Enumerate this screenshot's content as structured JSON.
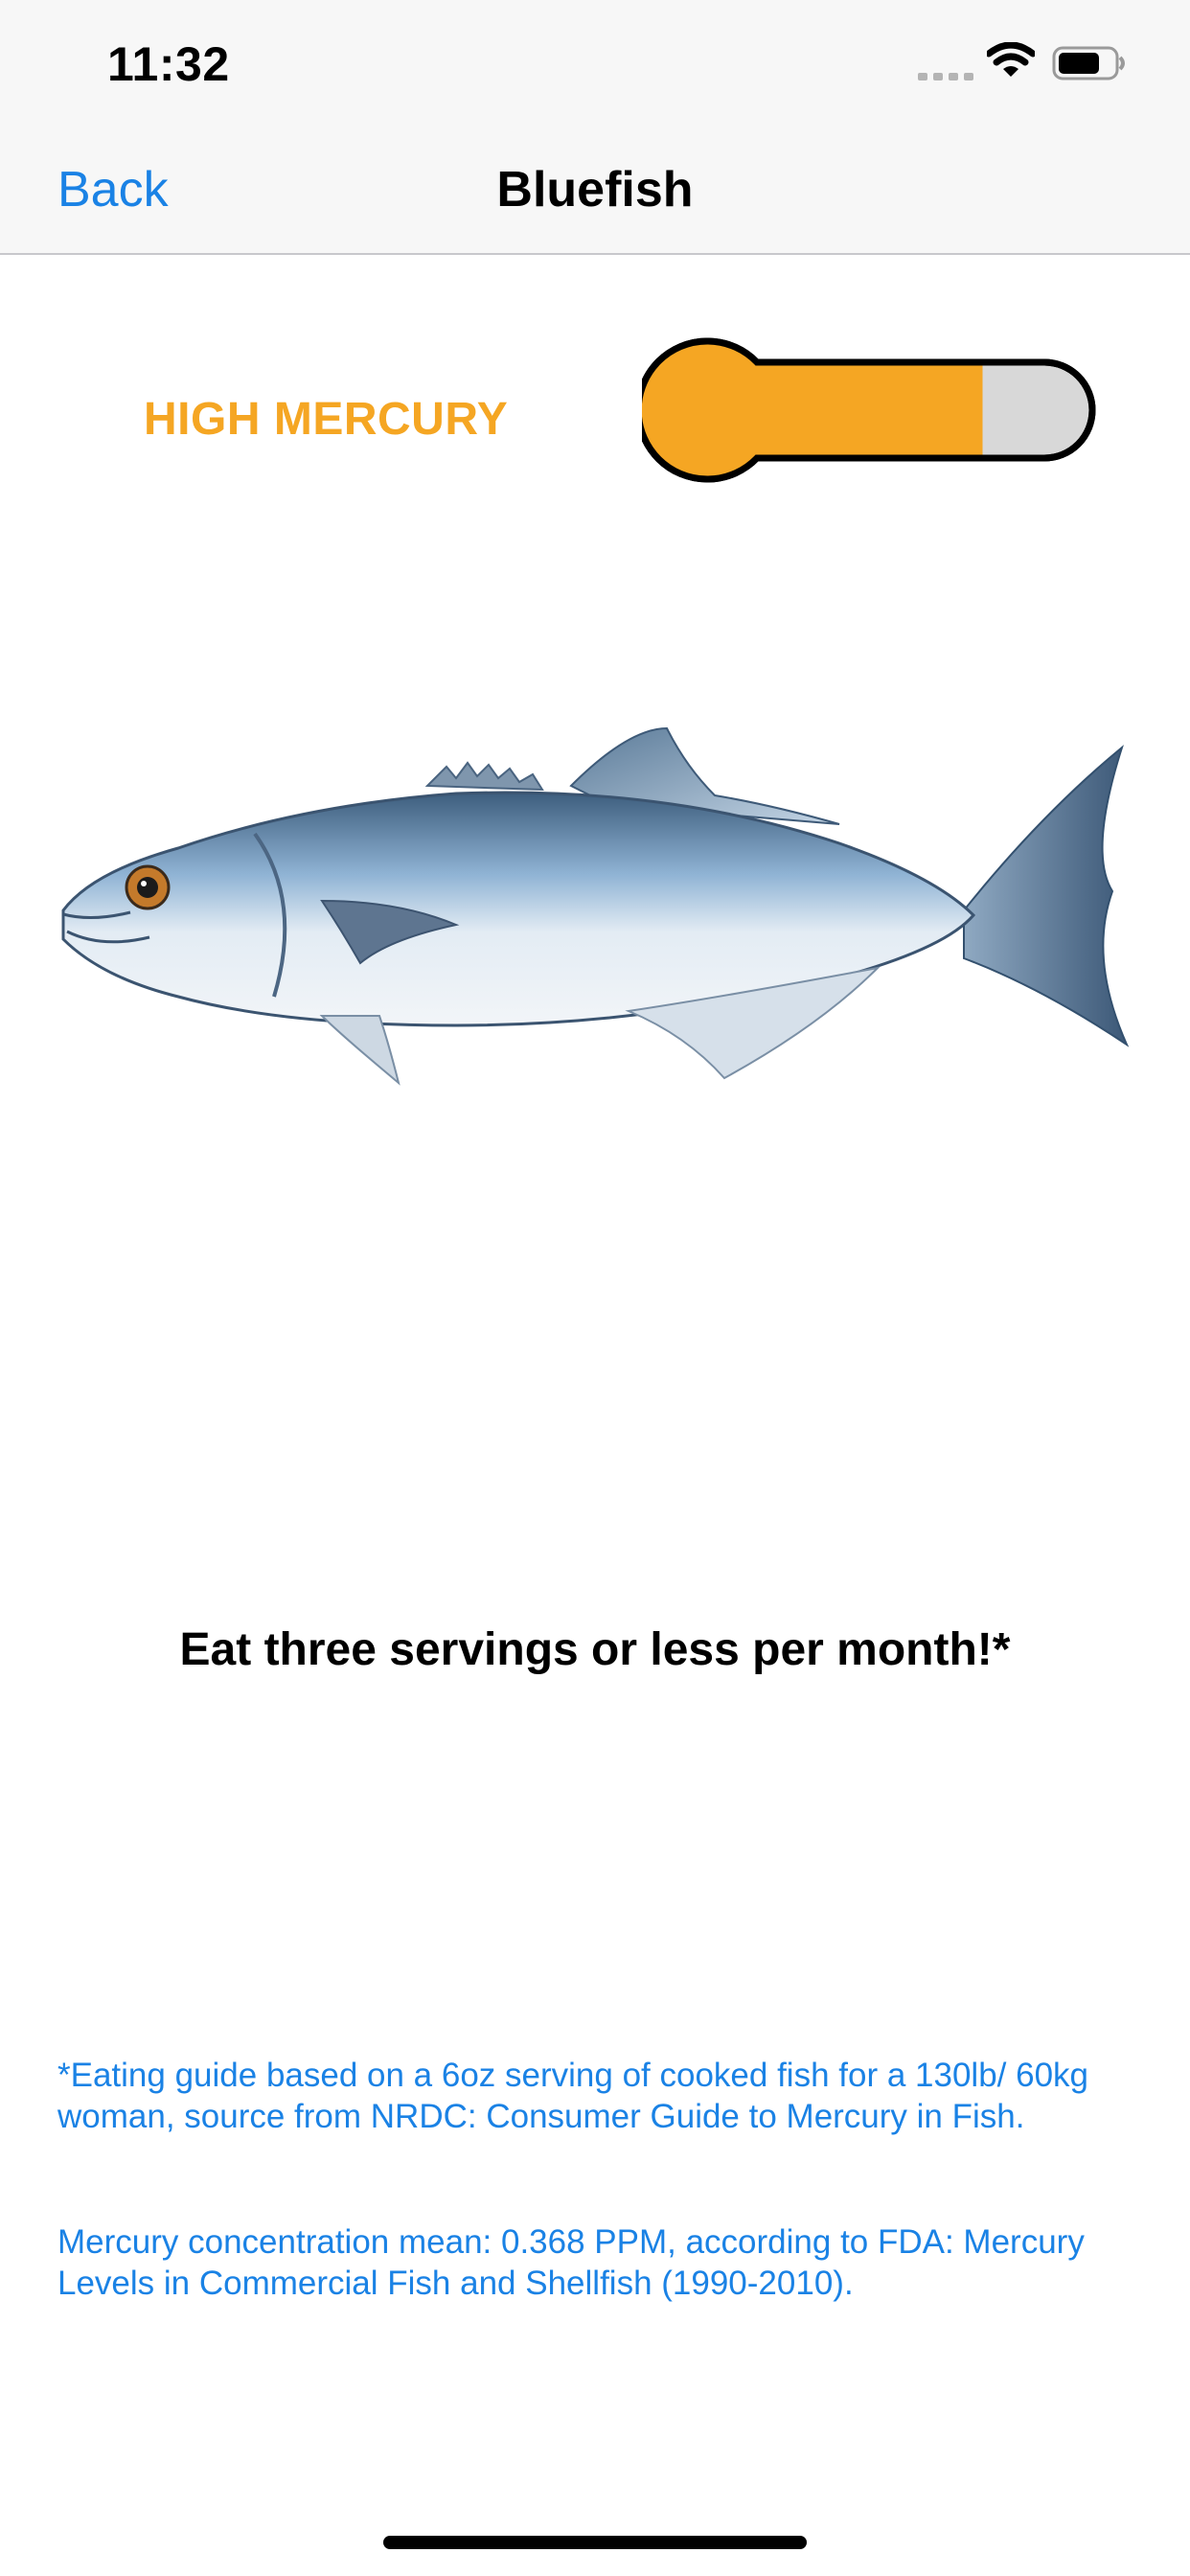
{
  "status_bar": {
    "time": "11:32"
  },
  "nav": {
    "back_label": "Back",
    "title": "Bluefish"
  },
  "mercury": {
    "label": "HIGH MERCURY",
    "level_fraction": 0.75,
    "fill_color": "#f5a623",
    "empty_color": "#d8d8d8"
  },
  "fish": {
    "icon": "bluefish-illustration"
  },
  "advice": "Eat three servings or less per month!*",
  "footnotes": [
    "*Eating guide based on a 6oz serving of cooked fish for a 130lb/ 60kg woman, source from NRDC: Consumer Guide to Mercury in Fish.",
    "Mercury concentration mean: 0.368 PPM, according to FDA: Mercury Levels in Commercial Fish and Shellfish (1990-2010)."
  ],
  "colors": {
    "accent": "#1a82e5",
    "warning": "#f5a623"
  }
}
